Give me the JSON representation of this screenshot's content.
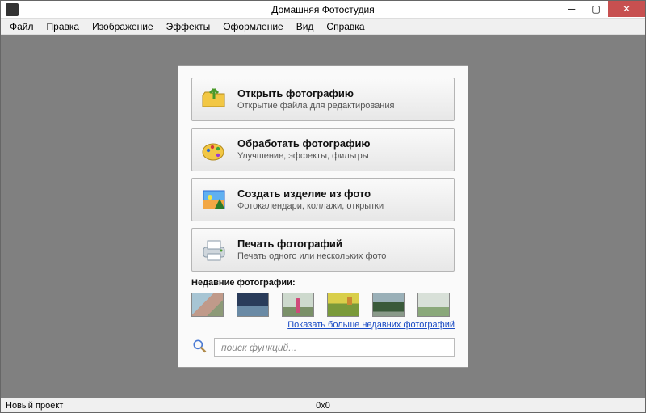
{
  "title": "Домашняя Фотостудия",
  "menu": {
    "file": "Файл",
    "edit": "Правка",
    "image": "Изображение",
    "effects": "Эффекты",
    "design": "Оформление",
    "view": "Вид",
    "help": "Справка"
  },
  "actions": {
    "open": {
      "title": "Открыть фотографию",
      "sub": "Открытие файла для редактирования"
    },
    "edit": {
      "title": "Обработать фотографию",
      "sub": "Улучшение, эффекты, фильтры"
    },
    "create": {
      "title": "Создать изделие из фото",
      "sub": "Фотокалендари, коллажи, открытки"
    },
    "print": {
      "title": "Печать фотографий",
      "sub": "Печать одного или нескольких фото"
    }
  },
  "recent_label": "Недавние фотографии:",
  "more_link": "Показать больше недавних фотографий",
  "search": {
    "placeholder": "поиск функций..."
  },
  "status": {
    "project": "Новый проект",
    "dims": "0x0"
  }
}
